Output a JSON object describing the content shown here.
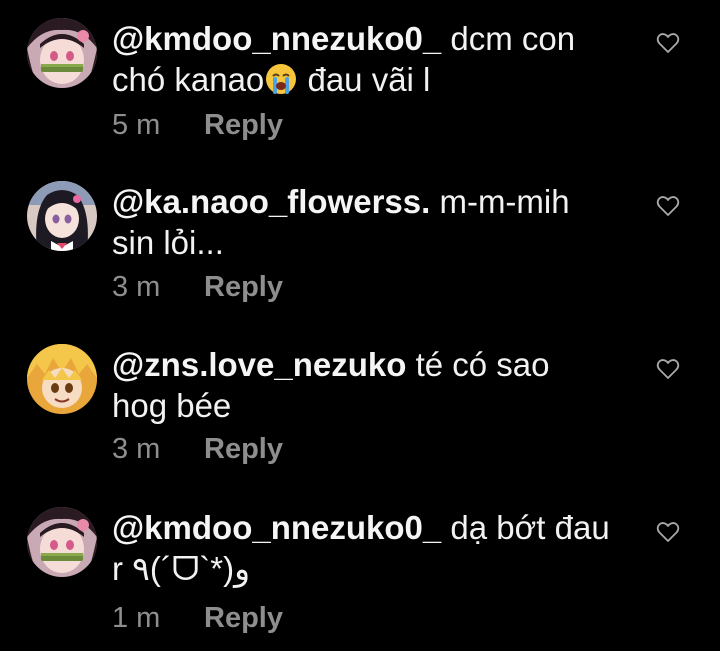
{
  "comments": [
    {
      "username": "@kmdoo_nnezuko0_",
      "text_before": " dcm con chó kanao",
      "emoji_icon": "crying-face-icon",
      "text_after": " đau vãi l",
      "time": "5 m",
      "reply": "Reply",
      "avatar_icon": "nezuko-avatar"
    },
    {
      "username": "@ka.naoo_flowerss.",
      "text_before": " m-m-mih sin lỏi...",
      "emoji_icon": "",
      "text_after": "",
      "time": "3 m",
      "reply": "Reply",
      "avatar_icon": "kanao-avatar"
    },
    {
      "username": "@zns.love_nezuko",
      "text_before": " té có sao hog bée",
      "emoji_icon": "",
      "text_after": "",
      "time": "3 m",
      "reply": "Reply",
      "avatar_icon": "zenitsu-avatar"
    },
    {
      "username": "@kmdoo_nnezuko0_",
      "text_before": " dạ bớt đau r ٩(´ᗜ`*)و",
      "emoji_icon": "",
      "text_after": "",
      "time": "1 m",
      "reply": "Reply",
      "avatar_icon": "nezuko-avatar"
    }
  ],
  "colors": {
    "background": "#000000",
    "text": "#f2f2f2",
    "meta": "#8e8e8e"
  }
}
